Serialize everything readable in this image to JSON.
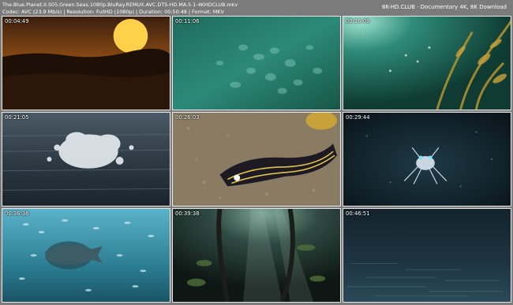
{
  "header": {
    "filename": "The.Blue.Planet.II.S05.Green.Seas.1080p.BluRay.REMUX.AVC.DTS-HD.MA.5.1-4KHDCLUB.mkv",
    "codec_line": "Codec: AVC (23.9 Mb/s)  |  Resolution: FullHD (1080p)  |  Duration: 00:50:48  |  Format: MKV",
    "brand": "8K-HD.CLUB · Documentary 4K, 8K Download"
  },
  "thumbnails": [
    {
      "time": "00:04:49",
      "scene": "sunset"
    },
    {
      "time": "00:11:06",
      "scene": "jellyfish"
    },
    {
      "time": "00:16:09",
      "scene": "kelp-forest"
    },
    {
      "time": "00:21:05",
      "scene": "splash"
    },
    {
      "time": "00:26:03",
      "scene": "sea-slug"
    },
    {
      "time": "00:29:44",
      "scene": "deep-sea-creature"
    },
    {
      "time": "00:36:36",
      "scene": "fish-school"
    },
    {
      "time": "00:39:38",
      "scene": "mangrove"
    },
    {
      "time": "00:46:51",
      "scene": "dark-water"
    }
  ],
  "colors": {
    "background": "#7b7b7b",
    "border": "#e8e8e8",
    "text": "#ffffff"
  }
}
